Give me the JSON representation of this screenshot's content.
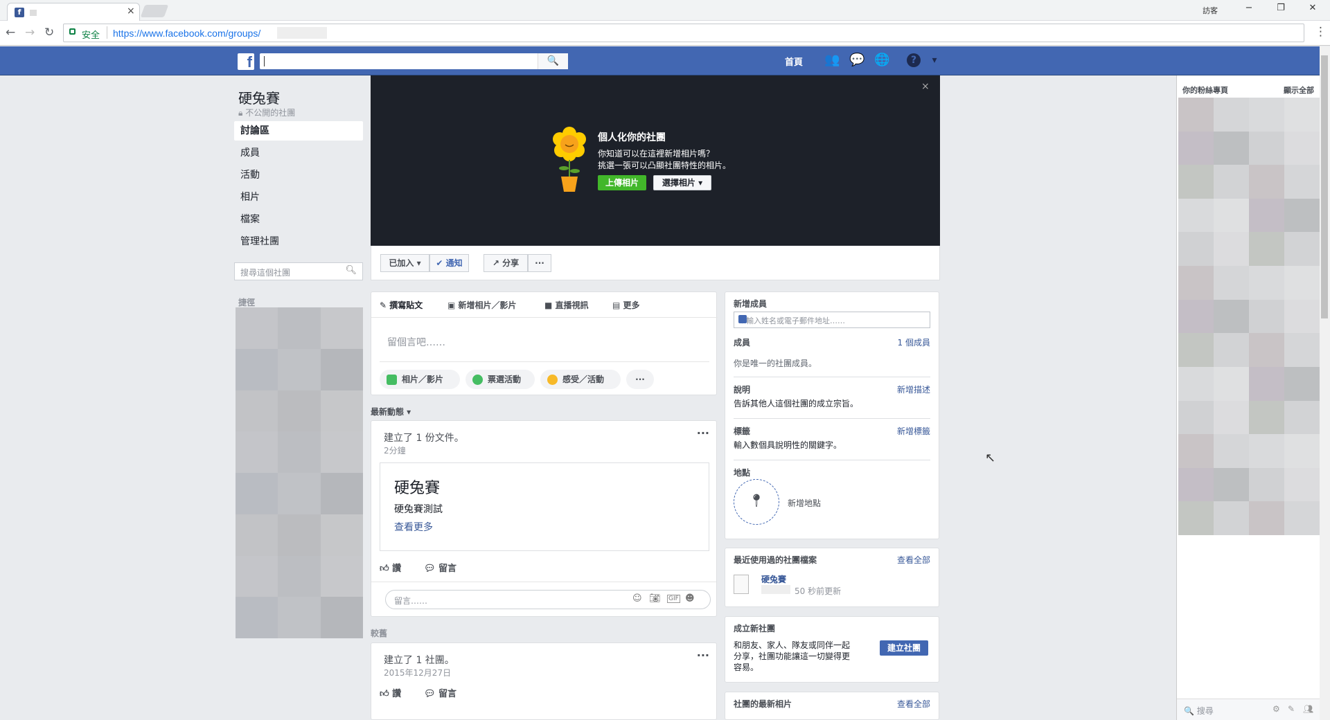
{
  "browser": {
    "tab_close": "×",
    "user": "訪客",
    "minimize": "−",
    "restore": "❐",
    "close": "✕",
    "secure_label": "安全",
    "url": "https://www.facebook.com/groups/",
    "menu": "⋮",
    "back_icon": "←",
    "forward_icon": "→",
    "reload_icon": "↻"
  },
  "header": {
    "logo": "f",
    "search_icon": "🔍",
    "home": "首頁",
    "friends_icon": "👥",
    "messenger_icon": "💬",
    "globe_icon": "🌐",
    "help_icon": "?",
    "dropdown_icon": "▾"
  },
  "group": {
    "name": "硬兔賽",
    "privacy": "不公開的社團",
    "nav": [
      "討論區",
      "成員",
      "活動",
      "相片",
      "檔案",
      "管理社團"
    ],
    "search_placeholder": "搜尋這個社團",
    "shortcuts": "捷徑"
  },
  "cover": {
    "title": "個人化你的社團",
    "desc1": "你知道可以在這裡新增相片嗎？",
    "desc2": "挑選一張可以凸顯社團特性的相片。",
    "upload": "上傳相片",
    "choose": "選擇相片 ▾",
    "close": "×"
  },
  "actions": {
    "joined": "已加入 ▾",
    "notify": "✔ 通知",
    "share": "↗ 分享",
    "more": "···"
  },
  "composer": {
    "tabs": [
      "✎ 撰寫貼文",
      "▣ 新增相片／影片",
      "■ 直播視訊",
      "▤ 更多"
    ],
    "placeholder": "留個言吧……",
    "pills": [
      "相片／影片",
      "票選活動",
      "感受／活動"
    ],
    "more": "···"
  },
  "feed": {
    "recent": "最新動態 ▾",
    "post1": {
      "title": "建立了 1 份文件。",
      "time": "2分鐘",
      "doc_title": "硬兔賽",
      "doc_desc": "硬兔賽測試",
      "doc_more": "查看更多",
      "like": "讚",
      "comment": "留言",
      "comment_placeholder": "留言……"
    },
    "older": "較舊",
    "post2": {
      "title": "建立了 1 社團。",
      "time": "2015年12月27日",
      "like": "讚",
      "comment": "留言"
    },
    "dots": "···"
  },
  "sidebar": {
    "add_members": "新增成員",
    "add_placeholder": "＋輸入姓名或電子郵件地址……",
    "members": "成員",
    "members_count": "1 個成員",
    "members_desc": "你是唯一的社團成員。",
    "desc": "說明",
    "desc_link": "新增描述",
    "desc_text": "告訴其他人這個社團的成立宗旨。",
    "tags": "標籤",
    "tags_link": "新增標籤",
    "tags_text": "輸入數個具說明性的關鍵字。",
    "location": "地點",
    "location_link": "新增地點",
    "recent_files": "最近使用過的社團檔案",
    "see_all": "查看全部",
    "file_name": "硬兔賽",
    "file_updated": "50 秒前更新",
    "create_group": "成立新社團",
    "create_desc1": "和朋友、家人、隊友或同伴一起",
    "create_desc2": "分享，社團功能讓這一切變得更",
    "create_desc3": "容易。",
    "create_btn": "建立社團",
    "new_photos": "社團的最新相片",
    "see_all2": "查看全部"
  },
  "chat": {
    "pages": "你的粉絲專頁",
    "show_all": "顯示全部",
    "search": "🔍 搜尋"
  },
  "colors": {
    "fb_blue": "#4267b2",
    "green": "#42b72a",
    "cover_bg": "#1d2129"
  }
}
